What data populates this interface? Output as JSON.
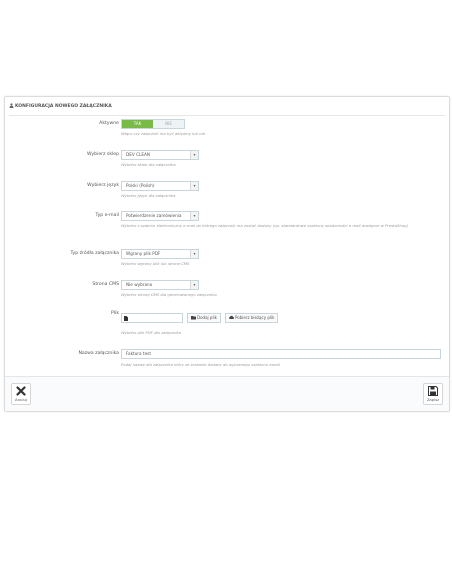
{
  "panel": {
    "title": "KONFIGURACJA NOWEGO ZAŁĄCZNIKA"
  },
  "active": {
    "label": "Aktywne",
    "yes": "TAK",
    "no": "NIE",
    "help": "Włącz czy załącznik ma być aktywny lub nie."
  },
  "shop": {
    "label": "Wybierz sklep",
    "value": "DEV CLEAN",
    "help": "Wybierz sklep dla załącznika"
  },
  "language": {
    "label": "Wybierz język",
    "value": "Polski (Polish)",
    "help": "Wybierz język dla załącznika"
  },
  "email_type": {
    "label": "Typ e-mail",
    "value": "Potwierdzenie zamówienia",
    "help": "Wybierz z szablon elektroniczny e-mail do którego załącznik ma zostać dodany (np. standardowe szablony wiadomości e-mail dostępne w PrestaShop)"
  },
  "source_type": {
    "label": "Typ źródła załącznika",
    "value": "Wgrany plik PDF",
    "help": "Wybierz wgrany plik lub stronę CMS"
  },
  "cms_page": {
    "label": "Strona CMS",
    "value": "Nie wybrano",
    "help": "Wybierz stronę CMS dla generowanego załącznika"
  },
  "file": {
    "label": "Plik",
    "add_label": "Dodaj plik",
    "download_label": "Pobierz bieżący plik",
    "help": "Wybierz plik PDF dla załącznika"
  },
  "attachment_name": {
    "label": "Nazwa załącznika",
    "value": "Faktura test",
    "help": "Podaj nazwę dla załącznika który ze zostanie dodany do wybranego szablonu email"
  },
  "footer": {
    "cancel_label": "Anuluj",
    "save_label": "Zapisz"
  }
}
